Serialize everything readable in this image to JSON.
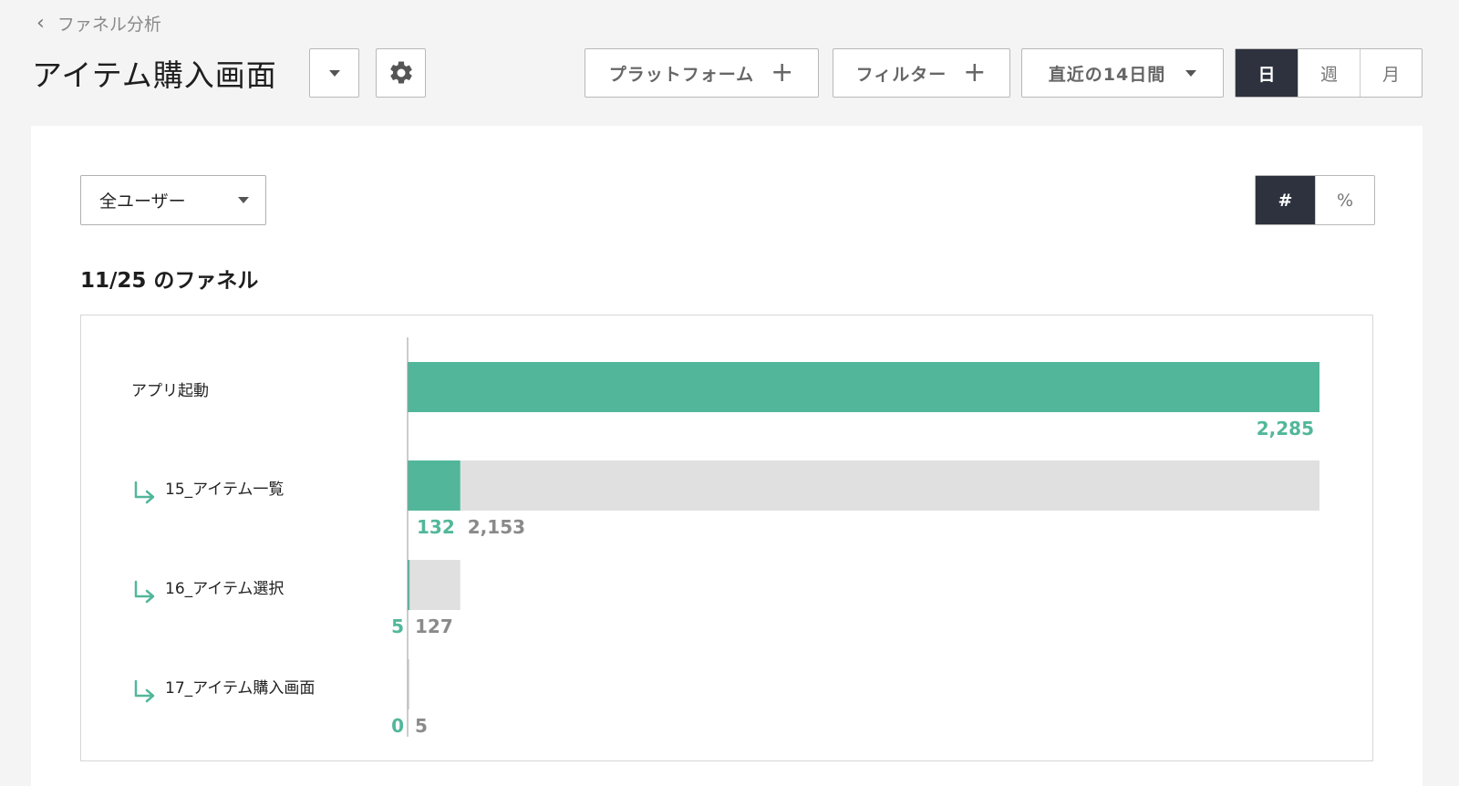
{
  "nav": {
    "back_label": "ファネル分析"
  },
  "header": {
    "title": "アイテム購入画面"
  },
  "toolbar": {
    "platform_label": "プラットフォーム",
    "filter_label": "フィルター",
    "date_range_label": "直近の14日間",
    "period_options": [
      "日",
      "週",
      "月"
    ],
    "period_selected": "日"
  },
  "segment": {
    "selected": "全ユーザー"
  },
  "display_mode": {
    "options": [
      "#",
      "%"
    ],
    "selected": "#"
  },
  "funnel": {
    "heading": "11/25 のファネル"
  },
  "colors": {
    "converted": "#52b79a",
    "dropoff": "#e0e0e0",
    "dark": "#2d323e"
  },
  "chart_data": {
    "type": "bar",
    "orientation": "horizontal",
    "stacked": true,
    "categories": [
      "アプリ起動",
      "15_アイテム一覧",
      "16_アイテム選択",
      "17_アイテム購入画面"
    ],
    "series": [
      {
        "values": [
          2285,
          132,
          5,
          0
        ]
      },
      {
        "values": [
          0,
          2153,
          127,
          5
        ]
      }
    ],
    "converted_labels": [
      "2,285",
      "132",
      "5",
      "0"
    ],
    "dropoff_labels": [
      "",
      "2,153",
      "127",
      "5"
    ],
    "xlim": [
      0,
      2285
    ],
    "grid": false
  }
}
